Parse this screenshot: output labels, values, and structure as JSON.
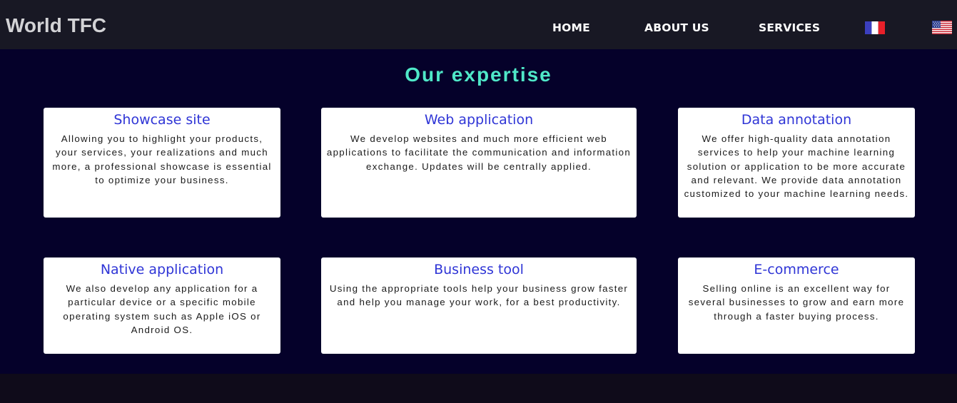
{
  "brand": {
    "name": "World TFC"
  },
  "nav": {
    "items": [
      {
        "label": "HOME"
      },
      {
        "label": "ABOUT US"
      },
      {
        "label": "SERVICES"
      }
    ],
    "flags": [
      {
        "icon": "france-flag-icon"
      },
      {
        "icon": "us-flag-icon"
      }
    ]
  },
  "section": {
    "title": "Our expertise",
    "cards": [
      {
        "title": "Showcase site",
        "text": "Allowing you to highlight your products, your services, your realizations and much more, a professional showcase is essential to optimize your business."
      },
      {
        "title": "Web application",
        "text": "We develop websites and much more efficient web applications to facilitate the communication and information exchange. Updates will be centrally applied."
      },
      {
        "title": "Data annotation",
        "text": "We offer high-quality data annotation services to help your machine learning solution or application to be more accurate and relevant. We provide data annotation customized to your machine learning needs."
      },
      {
        "title": "Native application",
        "text": "We also develop any application for a particular device or a specific mobile operating system such as Apple iOS or Android OS."
      },
      {
        "title": "Business tool",
        "text": "Using the appropriate tools help your business grow faster and help you manage your work, for a best productivity."
      },
      {
        "title": "E-commerce",
        "text": "Selling online is an excellent way for several businesses to grow and earn more through a faster buying process."
      }
    ]
  },
  "colors": {
    "navbar_bg": "#181824",
    "section_bg": "#05012a",
    "title_accent": "#4fe8c8",
    "card_title": "#2f35d6"
  }
}
